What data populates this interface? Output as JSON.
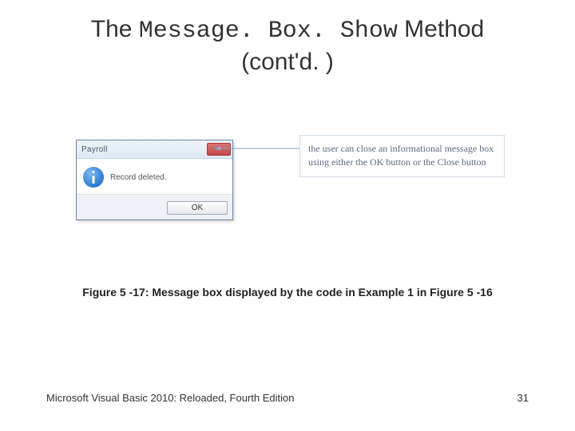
{
  "title": {
    "prefix": "The ",
    "code": "Message. Box. Show",
    "suffix": " Method",
    "line2": "(cont'd. )"
  },
  "msgbox": {
    "title": "Payroll",
    "close": "×",
    "text": "Record deleted.",
    "ok": "OK"
  },
  "annotation": "the user can close an informational message box using either the OK button or the Close button",
  "caption": "Figure 5 -17: Message box displayed by the code in Example 1 in Figure 5 -16",
  "footer": {
    "left": "Microsoft Visual Basic 2010: Reloaded, Fourth Edition",
    "right": "31"
  }
}
